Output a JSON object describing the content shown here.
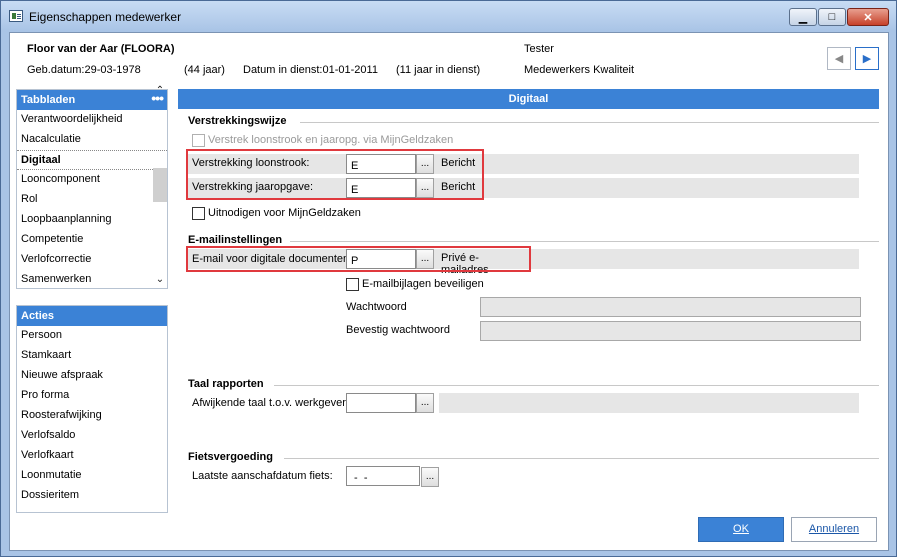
{
  "window": {
    "title": "Eigenschappen medewerker",
    "controls": {
      "minimize": "▁",
      "maximize": "□",
      "close": "✕"
    }
  },
  "employee": {
    "name": "Floor van der Aar (FLOORA)",
    "birth": "Geb.datum:29-03-1978",
    "age": "(44 jaar)",
    "in_service": "Datum in dienst:01-01-2011",
    "service_years": "(11 jaar in dienst)",
    "role": "Tester",
    "department": "Medewerkers Kwaliteit"
  },
  "nav": {
    "prev": "◀",
    "next": "▶"
  },
  "tabbladen": {
    "header": "Tabbladen",
    "more": "•••",
    "items": [
      {
        "label": "Verantwoordelijkheid"
      },
      {
        "label": "Nacalculatie"
      },
      {
        "label": "Digitaal",
        "selected": true
      },
      {
        "label": "Looncomponent"
      },
      {
        "label": "Rol"
      },
      {
        "label": "Loopbaanplanning"
      },
      {
        "label": "Competentie"
      },
      {
        "label": "Verlofcorrectie"
      },
      {
        "label": "Samenwerken"
      }
    ],
    "scroll_up": "⌃",
    "scroll_down": "⌄"
  },
  "acties": {
    "header": "Acties",
    "items": [
      {
        "label": "Persoon"
      },
      {
        "label": "Stamkaart"
      },
      {
        "label": "Nieuwe afspraak"
      },
      {
        "label": "Pro forma"
      },
      {
        "label": "Roosterafwijking"
      },
      {
        "label": "Verlofsaldo"
      },
      {
        "label": "Verlofkaart"
      },
      {
        "label": "Loonmutatie"
      },
      {
        "label": "Dossieritem"
      }
    ]
  },
  "main": {
    "header": "Digitaal",
    "verstrekkingswijze": {
      "title": "Verstrekkingswijze",
      "mijngeldzaken_label": "Verstrek loonstrook en jaaropg. via MijnGeldzaken",
      "loonstrook_label": "Verstrekking loonstrook:",
      "loonstrook_value": "E",
      "loonstrook_desc": "Bericht",
      "jaaropgave_label": "Verstrekking jaaropgave:",
      "jaaropgave_value": "E",
      "jaaropgave_desc": "Bericht",
      "uitnodigen_label": "Uitnodigen voor MijnGeldzaken"
    },
    "email": {
      "title": "E-mailinstellingen",
      "digital_docs_label": "E-mail voor digitale documenten:",
      "digital_docs_value": "P",
      "digital_docs_desc": "Privé e-mailadres",
      "beveiligen_label": "E-mailbijlagen beveiligen",
      "wachtwoord_label": "Wachtwoord",
      "bevestig_label": "Bevestig wachtwoord"
    },
    "taal": {
      "title": "Taal rapporten",
      "afwijkend_label": "Afwijkende taal t.o.v. werkgever:",
      "afwijkend_value": ""
    },
    "fiets": {
      "title": "Fietsvergoeding",
      "aanschaf_label": "Laatste aanschafdatum fiets:",
      "aanschaf_value": " -  -"
    },
    "lookup_button": "..."
  },
  "buttons": {
    "ok": "OK",
    "cancel": "Annuleren"
  },
  "colors": {
    "accent": "#3b82d6",
    "highlight_box": "#e0393e",
    "title_bar": "#a9c4e6"
  }
}
